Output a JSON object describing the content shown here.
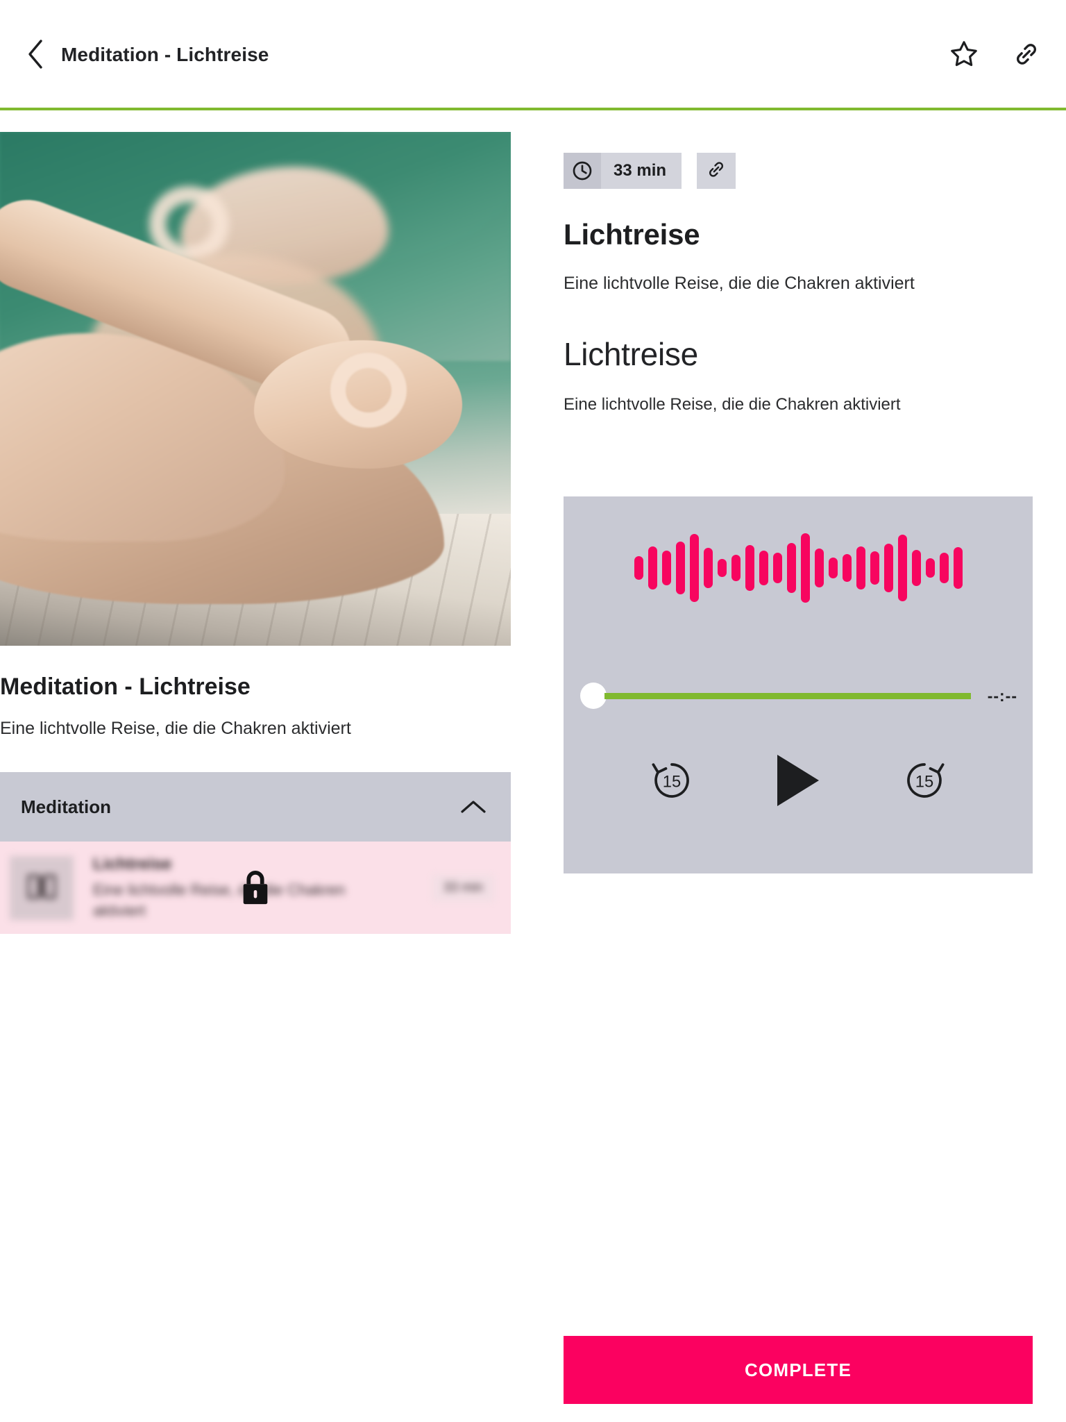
{
  "theme": {
    "accent_pink": "#fb0160",
    "accent_green": "#80b92f",
    "panel_gray": "#c8c9d3",
    "locked_pink": "#fbe0e8",
    "text_dark": "#1d1e20"
  },
  "topbar": {
    "back_icon": "chevron-left-icon",
    "title": "Meditation - Lichtreise",
    "favorite_icon": "star-icon",
    "share_icon": "link-icon"
  },
  "left": {
    "hero_image_alt": "woman-meditating-lotus-pose",
    "title": "Meditation - Lichtreise",
    "subtitle": "Eine lichtvolle Reise, die die Chakren aktiviert",
    "accordion": {
      "label": "Meditation",
      "chevron_icon": "chevron-up-icon",
      "expanded": true
    },
    "lesson": {
      "thumb_icon": "book-icon",
      "name": "Lichtreise",
      "description": "Eine lichtvolle Reise, die die Chakren aktiviert",
      "duration": "33 min",
      "locked": true,
      "lock_icon": "lock-icon"
    }
  },
  "right": {
    "chips": {
      "clock_icon": "clock-icon",
      "duration": "33 min",
      "link_icon": "link-icon"
    },
    "title_primary": "Lichtreise",
    "subtitle_primary": "Eine lichtvolle Reise, die die Chakren aktiviert",
    "title_secondary": "Lichtreise",
    "subtitle_secondary": "Eine lichtvolle Reise, die die Chakren aktiviert",
    "player": {
      "waveform_color": "#f7055f",
      "waveform_heights": [
        34,
        62,
        50,
        76,
        98,
        58,
        26,
        38,
        66,
        50,
        44,
        72,
        100,
        56,
        30,
        40,
        62,
        48,
        70,
        96,
        52,
        28,
        44,
        60
      ],
      "progress_percent": 0,
      "time_remaining": "--:--",
      "rewind_icon": "replay-15-icon",
      "rewind_seconds": "15",
      "play_icon": "play-icon",
      "forward_icon": "forward-15-icon",
      "forward_seconds": "15"
    }
  },
  "complete_button": {
    "label": "COMPLETE"
  }
}
